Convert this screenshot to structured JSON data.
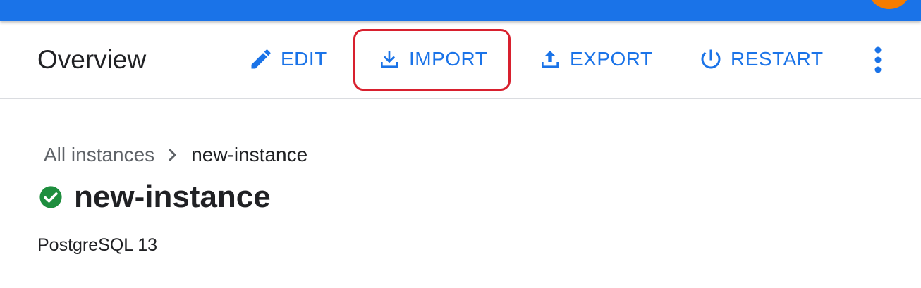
{
  "header": {
    "title": "Overview",
    "actions": {
      "edit_label": "EDIT",
      "import_label": "IMPORT",
      "export_label": "EXPORT",
      "restart_label": "RESTART"
    },
    "more_icon": "more-vert-icon"
  },
  "breadcrumb": {
    "parent": "All instances",
    "current": "new-instance"
  },
  "instance": {
    "name": "new-instance",
    "status_icon": "check-circle-icon",
    "status_color": "#1e8e3e",
    "database_version": "PostgreSQL 13"
  },
  "colors": {
    "topbar": "#1a73e8",
    "accent": "#1a73e8",
    "highlight": "#d8202e",
    "avatar": "#f57c00"
  }
}
